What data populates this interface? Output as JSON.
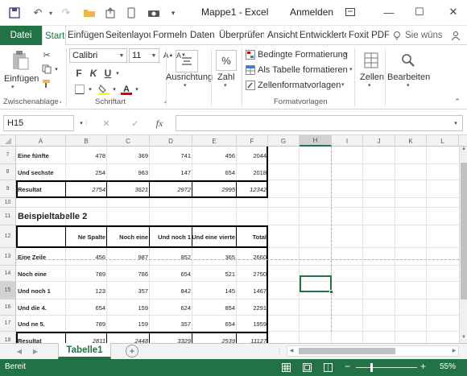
{
  "titlebar": {
    "title": "Mappe1  -  Excel",
    "signin": "Anmelden"
  },
  "tabs": {
    "file": "Datei",
    "items": [
      "Start",
      "Einfügen",
      "Seitenlayout",
      "Formeln",
      "Daten",
      "Überprüfen",
      "Ansicht",
      "Entwicklertools",
      "Foxit PDF"
    ],
    "tell_me": "Sie wünschen"
  },
  "ribbon": {
    "clipboard": {
      "paste_label": "Einfügen",
      "group_label": "Zwischenablage"
    },
    "font": {
      "name": "Calibri",
      "size": "11",
      "bold": "F",
      "italic": "K",
      "underline": "U",
      "group_label": "Schriftart"
    },
    "alignment": {
      "label": "Ausrichtung"
    },
    "number": {
      "label": "Zahl",
      "percent": "%"
    },
    "styles": {
      "conditional": "Bedingte Formatierung",
      "as_table": "Als Tabelle formatieren",
      "cell_styles": "Zellenformatvorlagen",
      "group_label": "Formatvorlagen"
    },
    "cells": {
      "label": "Zellen"
    },
    "editing": {
      "label": "Bearbeiten"
    }
  },
  "formula_bar": {
    "name_box": "H15",
    "fx": "fx",
    "value": ""
  },
  "grid": {
    "columns": [
      "A",
      "B",
      "C",
      "D",
      "E",
      "F",
      "G",
      "H",
      "I",
      "J",
      "K",
      "L"
    ],
    "selected_column": "H",
    "selected_row": "15",
    "rows": [
      {
        "n": "7",
        "a": "Eine fünfte",
        "b": "478",
        "c": "369",
        "d": "741",
        "e": "456",
        "f": "2044"
      },
      {
        "n": "8",
        "a": "Und sechste",
        "b": "254",
        "c": "963",
        "d": "147",
        "e": "654",
        "f": "2018"
      },
      {
        "n": "9",
        "a": "Resultat",
        "b": "2754",
        "c": "3621",
        "d": "2972",
        "e": "2995",
        "f": "12342"
      },
      {
        "n": "10",
        "a": "",
        "b": "",
        "c": "",
        "d": "",
        "e": "",
        "f": ""
      },
      {
        "n": "11",
        "a": "Beispieltabelle 2",
        "b": "",
        "c": "",
        "d": "",
        "e": "",
        "f": ""
      },
      {
        "n": "12",
        "a": "",
        "b": "Ne Spalte",
        "c": "Noch eine",
        "d": "Und noch 1",
        "e": "Und eine vierte",
        "f": "Total"
      },
      {
        "n": "13",
        "a": "Eine Zeile",
        "b": "456",
        "c": "987",
        "d": "852",
        "e": "365",
        "f": "2660"
      },
      {
        "n": "14",
        "a": "Noch eine",
        "b": "789",
        "c": "786",
        "d": "654",
        "e": "521",
        "f": "2750"
      },
      {
        "n": "15",
        "a": "Und noch 1",
        "b": "123",
        "c": "357",
        "d": "842",
        "e": "145",
        "f": "1467"
      },
      {
        "n": "16",
        "a": "Und die 4.",
        "b": "654",
        "c": "159",
        "d": "624",
        "e": "854",
        "f": "2291"
      },
      {
        "n": "17",
        "a": "Und ne 5.",
        "b": "789",
        "c": "159",
        "d": "357",
        "e": "654",
        "f": "1959"
      },
      {
        "n": "18",
        "a": "Resultat",
        "b": "2811",
        "c": "2448",
        "d": "3329",
        "e": "2539",
        "f": "11127"
      }
    ]
  },
  "sheets": {
    "active": "Tabelle1",
    "add_symbol": "+"
  },
  "status": {
    "ready": "Bereit",
    "zoom": "55%",
    "zoom_minus": "−",
    "zoom_plus": "+"
  }
}
